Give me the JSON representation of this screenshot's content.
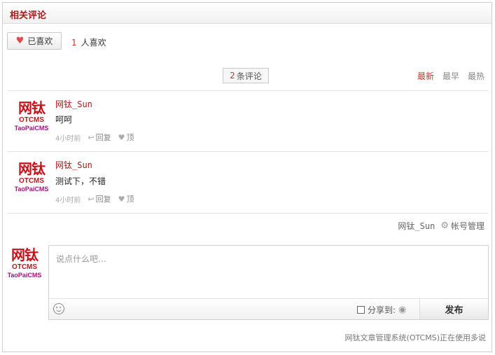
{
  "header": {
    "title": "相关评论"
  },
  "like": {
    "button_label": "已喜欢",
    "count": "1",
    "count_suffix": "人喜欢"
  },
  "comments_count": {
    "number": "2",
    "suffix": "条评论"
  },
  "sort": {
    "newest": "最新",
    "oldest": "最早",
    "hottest": "最热"
  },
  "logo": {
    "line1": "网钛",
    "line2": "OTCMS",
    "line3": "TaoPaiCMS"
  },
  "comments": [
    {
      "user": "网钛_Sun",
      "text": "呵呵",
      "time": "4小时前",
      "reply": "回复",
      "up": "顶"
    },
    {
      "user": "网钛_Sun",
      "text": "测试下，不错",
      "time": "4小时前",
      "reply": "回复",
      "up": "顶"
    }
  ],
  "account": {
    "user": "网钛_Sun",
    "manage": "帐号管理"
  },
  "editor": {
    "placeholder": "说点什么吧…",
    "share_label": "分享到:",
    "post_label": "发布"
  },
  "footer": {
    "text": "网钛文章管理系统(OTCMS)正在使用多说"
  },
  "colors": {
    "accent": "#a61b1b",
    "link_red": "#c0392b",
    "logo_red": "#c4121b",
    "logo_purple": "#a0127f"
  }
}
